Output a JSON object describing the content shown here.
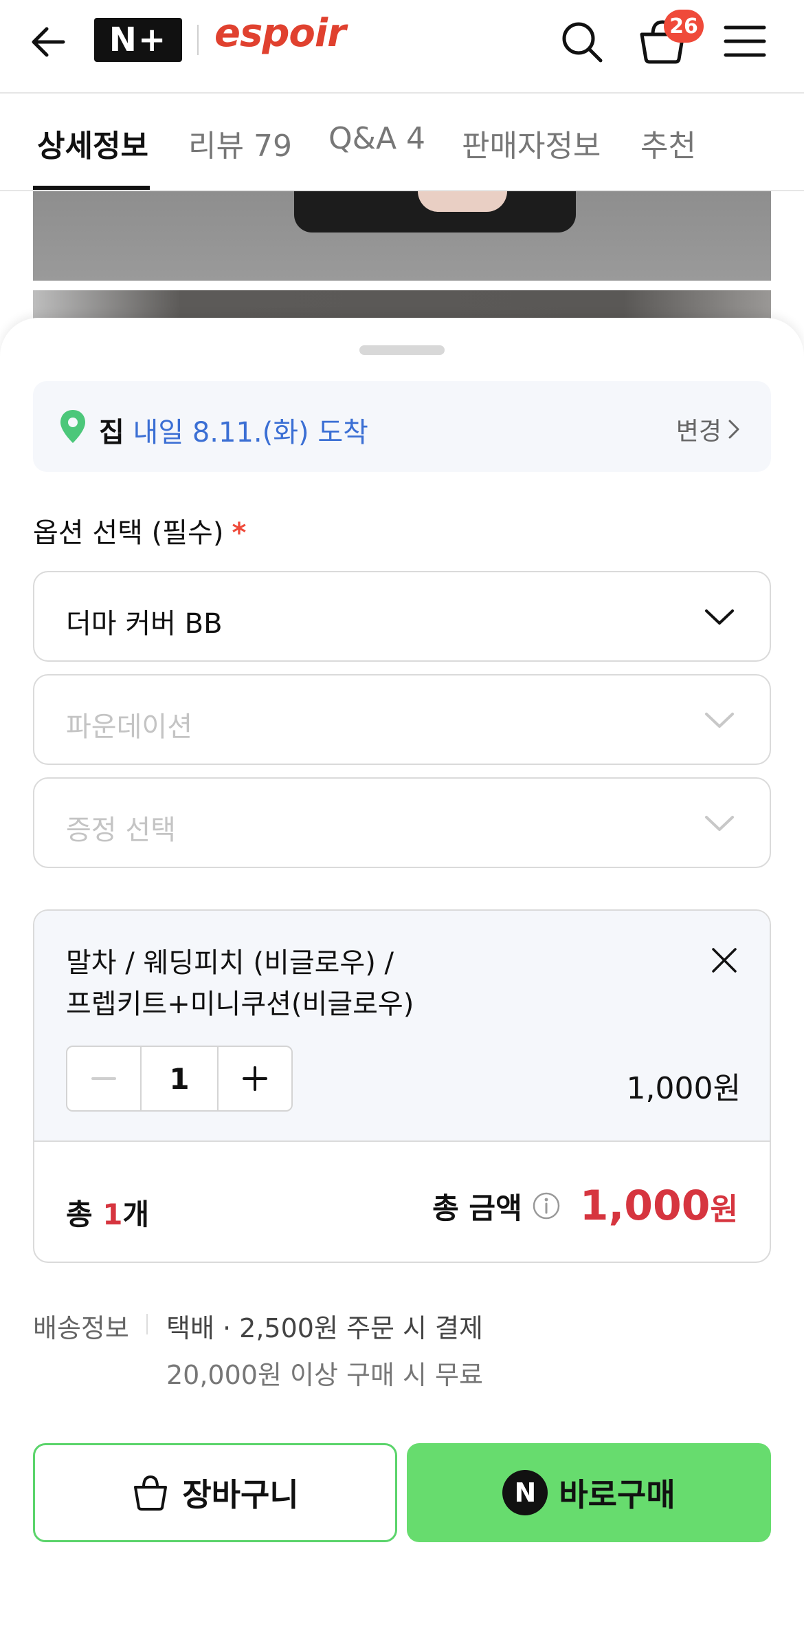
{
  "header": {
    "logo_text": "N+",
    "brand": "espoir",
    "cart_count": "26"
  },
  "tabs": [
    {
      "label": "상세정보"
    },
    {
      "label": "리뷰 79"
    },
    {
      "label": "Q&A 4"
    },
    {
      "label": "판매자정보"
    },
    {
      "label": "추천"
    }
  ],
  "delivery": {
    "place": "집",
    "date": "내일 8.11.(화) 도착",
    "change_label": "변경"
  },
  "options": {
    "title": "옵션 선택 (필수)",
    "required_mark": "*",
    "selects": [
      {
        "text": "더마 커버 BB",
        "state": "selected"
      },
      {
        "text": "파운데이션",
        "state": "placeholder"
      },
      {
        "text": "증정 선택",
        "state": "placeholder"
      }
    ]
  },
  "selected_item": {
    "name_line1": "말차 / 웨딩피치 (비글로우) /",
    "name_line2": "프렙키트+미니쿠션(비글로우)",
    "quantity": "1",
    "price": "1,000원"
  },
  "totals": {
    "count_prefix": "총 ",
    "count_num": "1",
    "count_suffix": "개",
    "amount_label": "총 금액",
    "amount_value": "1,000",
    "amount_unit": "원"
  },
  "shipping": {
    "label": "배송정보",
    "line1": "택배 · 2,500원 주문 시 결제",
    "line2": "20,000원 이상 구매 시 무료"
  },
  "buttons": {
    "cart_label": "장바구니",
    "buy_icon_letter": "N",
    "buy_label": "바로구매"
  },
  "colors": {
    "accent_red": "#d6353f",
    "link_blue": "#3b6fd4",
    "npay_green": "#67dc6e",
    "brand_red": "#e0412f"
  }
}
